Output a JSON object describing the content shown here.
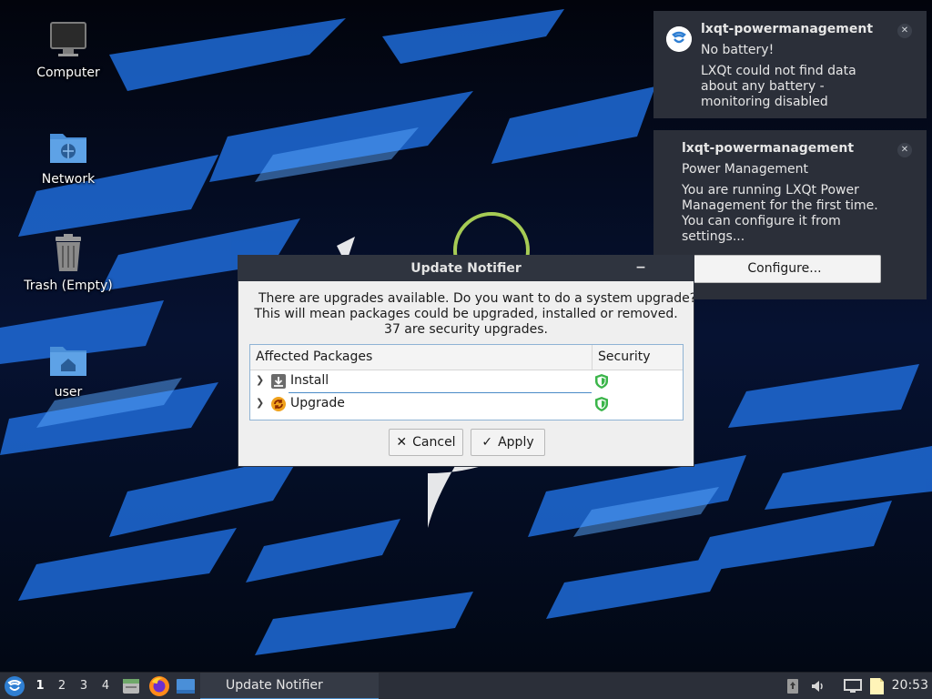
{
  "desktop": {
    "icons": [
      {
        "label": "Computer",
        "icon": "computer-icon"
      },
      {
        "label": "Network",
        "icon": "network-folder-icon"
      },
      {
        "label": "Trash (Empty)",
        "icon": "trash-icon"
      },
      {
        "label": "user",
        "icon": "home-folder-icon"
      }
    ]
  },
  "dialog": {
    "title": "Update Notifier",
    "minimize_glyph": "−",
    "message_line1": "There are upgrades available. Do you want to do a system upgrade?",
    "message_line2": "This will mean packages could be upgraded, installed or removed.",
    "message_line3": "37 are security upgrades.",
    "columns": [
      "Affected Packages",
      "Security"
    ],
    "rows": [
      {
        "label": "Install",
        "icon": "download-icon",
        "security": "shield-icon"
      },
      {
        "label": "Upgrade",
        "icon": "upgrade-icon",
        "security": "shield-icon"
      }
    ],
    "cancel_label": "Cancel",
    "apply_label": "Apply"
  },
  "notifications": [
    {
      "app": "lxqt-powermanagement",
      "summary": "No battery!",
      "body_line1": "LXQt could not find data",
      "body_line2": "about any battery -",
      "body_line3": "monitoring disabled"
    },
    {
      "app": "lxqt-powermanagement",
      "summary": "Power Management",
      "body_line1": "You are running LXQt Power",
      "body_line2": "Management for the first time.",
      "body_line3": "You can configure it from",
      "body_line4": "settings...",
      "action": "Configure..."
    }
  ],
  "taskbar": {
    "desktops": [
      "1",
      "2",
      "3",
      "4"
    ],
    "active_desktop": "1",
    "task_title": "Update Notifier",
    "clock": "20:53"
  },
  "colors": {
    "panel": "#2b2f39",
    "dialog_bg": "#efefef",
    "accent": "#4b8bc7",
    "shield": "#3bb54a"
  }
}
